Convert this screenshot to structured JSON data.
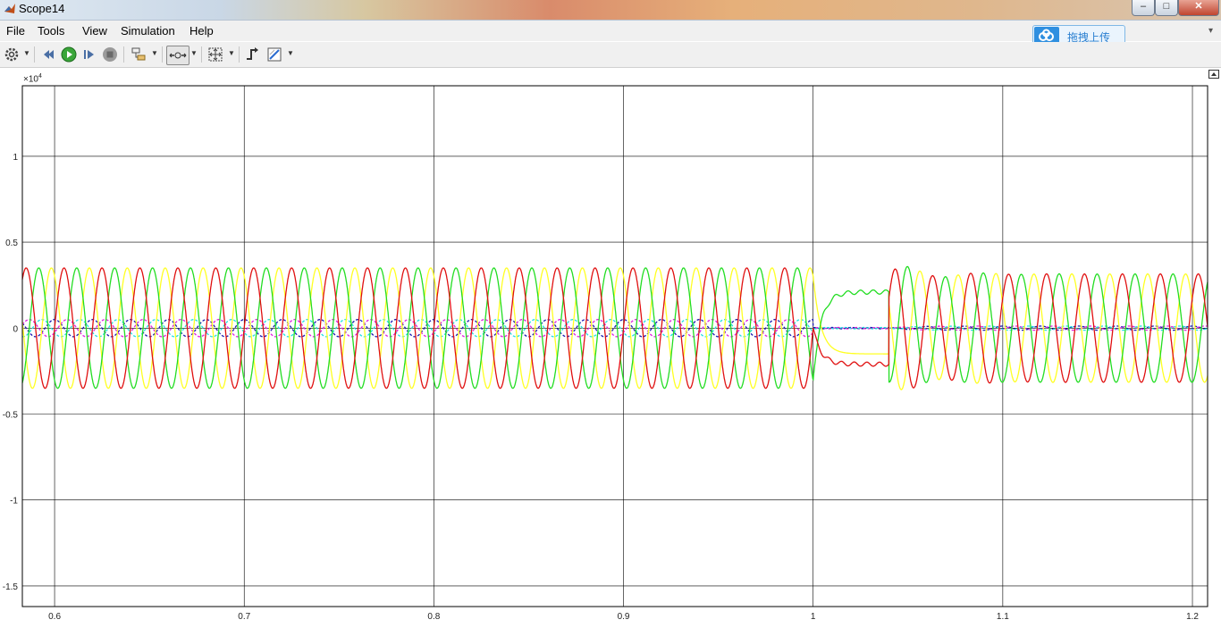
{
  "window": {
    "title": "Scope14",
    "minimize_glyph": "–",
    "maximize_glyph": "□",
    "close_glyph": "✕"
  },
  "menu": {
    "items": [
      {
        "label": "File"
      },
      {
        "label": "Tools"
      },
      {
        "label": "View"
      },
      {
        "label": "Simulation"
      },
      {
        "label": "Help"
      }
    ]
  },
  "overlay": {
    "upload_label": "拖拽上传"
  },
  "toolbar": {
    "icons": [
      "gear-icon",
      "step-back-icon",
      "run-icon",
      "step-forward-icon",
      "stop-icon",
      "signal-selector-icon",
      "zoom-icon",
      "autoscale-icon",
      "trigger-icon",
      "style-icon"
    ]
  },
  "plot": {
    "exponent_base": "×10",
    "exponent_power": "4",
    "background": "#ffffff",
    "grid_color": "#000000"
  },
  "chart_data": {
    "type": "line",
    "title": "",
    "xlabel": "",
    "ylabel": "",
    "xlim": [
      0.583,
      1.208
    ],
    "ylim": [
      -1.62,
      1.41
    ],
    "y_scale_factor": 10000,
    "grid": true,
    "x_ticks": [
      0.6,
      0.7,
      0.8,
      0.9,
      1,
      1.1,
      1.2
    ],
    "x_tick_labels": [
      "0.6",
      "0.7",
      "0.8",
      "0.9",
      "1",
      "1.1",
      "1.2"
    ],
    "y_ticks": [
      1,
      0.5,
      0,
      -0.5,
      -1,
      -1.5
    ],
    "y_tick_labels": [
      "1",
      "0.5",
      "0",
      "-0.5",
      "-1",
      "-1.5"
    ],
    "frequency_hz": 50,
    "series": [
      {
        "color": "#e01010",
        "amplitude": 0.35,
        "phase_deg": 0,
        "dashed": false
      },
      {
        "color": "#22dd22",
        "amplitude": 0.35,
        "phase_deg": -120,
        "dashed": false
      },
      {
        "color": "#ffff22",
        "amplitude": 0.35,
        "phase_deg": 120,
        "dashed": false
      },
      {
        "color": "#1a1ab0",
        "amplitude": 0.05,
        "phase_deg": 90,
        "dashed": true
      },
      {
        "color": "#e020e0",
        "amplitude": 0.05,
        "phase_deg": -30,
        "dashed": true
      },
      {
        "color": "#20e0e0",
        "amplitude": 0.05,
        "phase_deg": 210,
        "dashed": true
      }
    ],
    "events": {
      "fault_start": 1.0,
      "fault_end": 1.04,
      "fault_red_level": -0.21,
      "fault_green_level": 0.21,
      "fault_yellow_level": -0.15,
      "post_fault_amplitude": 0.35
    }
  }
}
